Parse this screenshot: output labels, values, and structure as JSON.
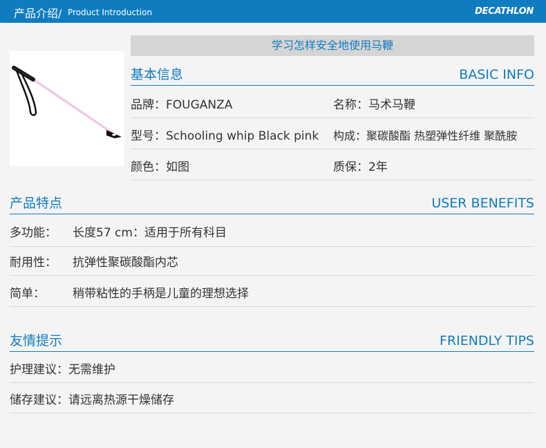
{
  "header": {
    "title_cn": "产品介绍/",
    "title_en": "Product Introduction",
    "brand": "DECATHLON",
    "bg_color": "#0f7cbf"
  },
  "product": {
    "image": "riding-whip-pink-black",
    "heading": "学习怎样安全地使用马鞭"
  },
  "basic_info": {
    "title_cn": "基本信息",
    "title_en": "BASIC INFO",
    "rows": [
      {
        "left_label": "品牌：",
        "left_value": "FOUGANZA",
        "right_label": "名称：",
        "right_value": "马术马鞭"
      },
      {
        "left_label": "型号：",
        "left_value": "Schooling whip Black pink",
        "right_label": "构成：",
        "right_value": "聚碳酸酯 热塑弹性纤维 聚酰胺"
      },
      {
        "left_label": "颜色：",
        "left_value": "如图",
        "right_label": "质保：",
        "right_value": "2年"
      }
    ]
  },
  "user_benefits": {
    "title_cn": "产品特点",
    "title_en": "USER BENEFITS",
    "rows": [
      {
        "label": "多功能：",
        "value": "长度57  cm：适用于所有科目"
      },
      {
        "label": "耐用性：",
        "value": "抗弹性聚碳酸酯内芯"
      },
      {
        "label": "简单：",
        "value": "稍带粘性的手柄是儿童的理想选择"
      }
    ]
  },
  "friendly_tips": {
    "title_cn": "友情提示",
    "title_en": "FRIENDLY TIPS",
    "rows": [
      {
        "label": "护理建议：",
        "value": "无需维护"
      },
      {
        "label": "储存建议：",
        "value": "请远离热源干燥储存"
      }
    ]
  },
  "colors": {
    "accent": "#0f7cbf",
    "band": "#d5d5d5",
    "background": "#f4f4f4",
    "whip_pink": "#f2d6ec"
  }
}
